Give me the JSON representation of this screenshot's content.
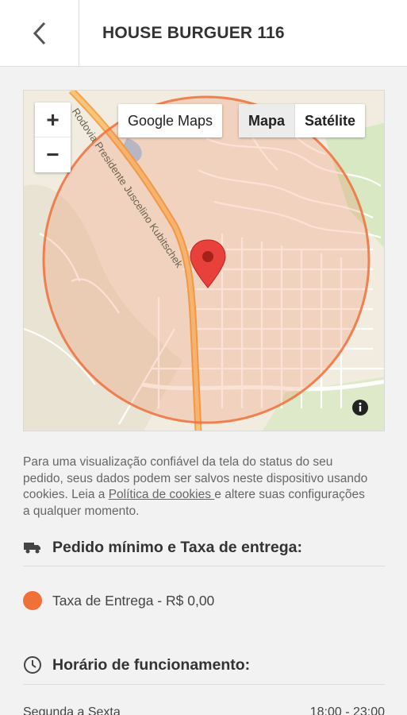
{
  "header": {
    "back_icon": "chevron-left-icon",
    "title": "HOUSE BURGUER 116"
  },
  "map": {
    "zoom_in": "+",
    "zoom_out": "−",
    "google_maps_label": "Google Maps",
    "map_types": [
      "Mapa",
      "Satélite"
    ],
    "selected_map_type": "Mapa",
    "road_label": "Rodovia Presidente Juscelino Kubitschek",
    "info_icon": "info-icon",
    "marker_icon": "map-pin-icon",
    "radius_color": "#f0703a"
  },
  "cookie_notice": {
    "text_before": "Para uma visualização confiável da tela do status do seu pedido, seus dados podem ser salvos neste dispositivo usando cookies. Leia a ",
    "link": "Política de cookies ",
    "text_after": "e altere suas configurações a qualquer momento."
  },
  "delivery": {
    "icon": "truck-icon",
    "title": "Pedido mínimo e Taxa de entrega:",
    "fee_label": "Taxa de Entrega - R$ 0,00",
    "fee_color": "#f0703a"
  },
  "hours": {
    "icon": "clock-icon",
    "title": "Horário de funcionamento:",
    "partial_row_days": "Segunda a Sexta",
    "partial_row_time": "18:00 - 23:00"
  }
}
